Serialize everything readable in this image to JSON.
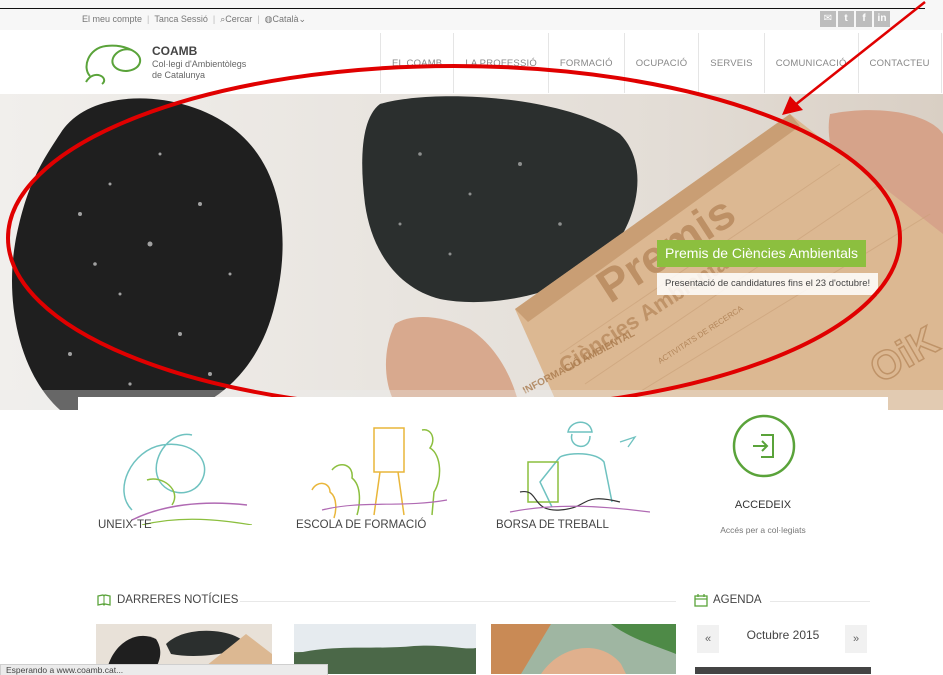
{
  "topbar": {
    "links": [
      "El meu compte",
      "Tanca Sessió",
      "Cercar",
      "Català"
    ],
    "social": [
      "✉",
      "t",
      "f",
      "in"
    ]
  },
  "header": {
    "brand": "COAMB",
    "subtitle_line1": "Col·legi d'Ambientòlegs",
    "subtitle_line2": "de Catalunya",
    "nav": [
      "EL COAMB",
      "LA PROFESSIÓ",
      "FORMACIÓ",
      "OCUPACIÓ",
      "SERVEIS",
      "COMUNICACIÓ",
      "CONTACTEU"
    ]
  },
  "hero": {
    "caption_title": "Premis de Ciències Ambientals",
    "caption_text": "Presentació de candidatures fins el 23 d'octubre!",
    "block_big": "Premis",
    "block_sub": "Ciències Ambientals",
    "block_small": "ACTIVITATS DE RECERCA",
    "block_info": "INFORMACIÓ AMBIENTAL",
    "block_oik": "OiK"
  },
  "features": {
    "uneix": "UNEIX-TE",
    "escola": "ESCOLA DE FORMACIÓ",
    "borsa": "BORSA DE TREBALL",
    "accedeix": "ACCEDEIX",
    "acces_sub": "Accés per a col·legiats"
  },
  "news": {
    "title": "DARRERES NOTÍCIES"
  },
  "agenda": {
    "title": "AGENDA",
    "month": "Octubre 2015",
    "prev": "«",
    "next": "»"
  },
  "status_bar": "Esperando a www.coamb.cat...",
  "colors": {
    "accent": "#8cbf3f",
    "annotation": "#e00000",
    "logo": "#5aa33a"
  }
}
